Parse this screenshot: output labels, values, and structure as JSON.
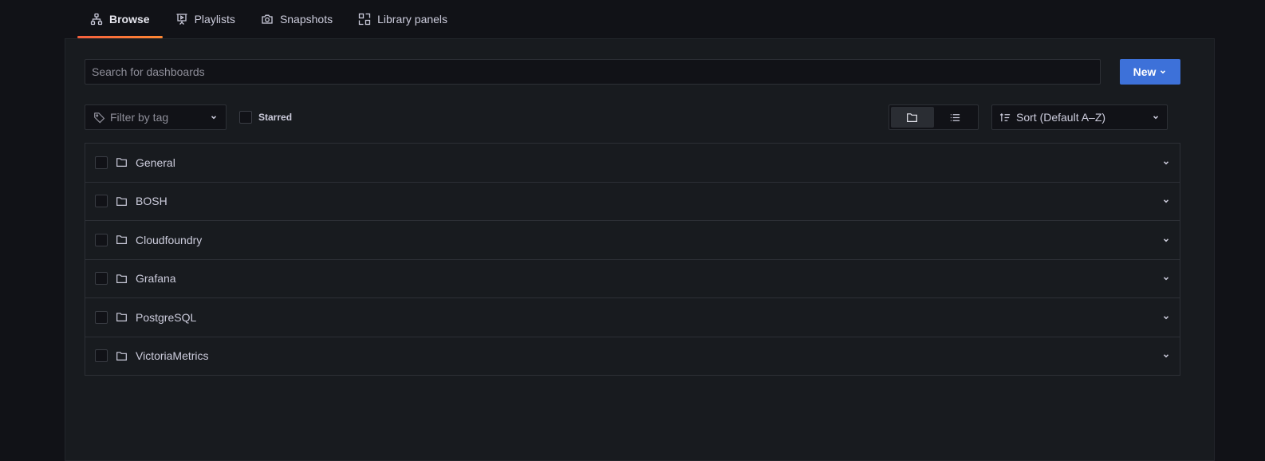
{
  "tabs": [
    {
      "label": "Browse",
      "icon": "sitemap-icon",
      "active": true
    },
    {
      "label": "Playlists",
      "icon": "presentation-icon",
      "active": false
    },
    {
      "label": "Snapshots",
      "icon": "camera-icon",
      "active": false
    },
    {
      "label": "Library panels",
      "icon": "library-panel-icon",
      "active": false
    }
  ],
  "search": {
    "placeholder": "Search for dashboards",
    "value": ""
  },
  "new_button": {
    "label": "New"
  },
  "tag_filter": {
    "placeholder": "Filter by tag"
  },
  "starred": {
    "label": "Starred",
    "checked": false
  },
  "view_toggle": {
    "options": [
      "folder-view",
      "list-view"
    ],
    "selected": "folder-view"
  },
  "sort": {
    "label": "Sort (Default A–Z)"
  },
  "folders": [
    {
      "name": "General"
    },
    {
      "name": "BOSH"
    },
    {
      "name": "Cloudfoundry"
    },
    {
      "name": "Grafana"
    },
    {
      "name": "PostgreSQL"
    },
    {
      "name": "VictoriaMetrics"
    }
  ],
  "colors": {
    "accent": "#3d71d9",
    "tab_underline": "#f55f3e",
    "background": "#111217",
    "panel": "#181b1f"
  }
}
